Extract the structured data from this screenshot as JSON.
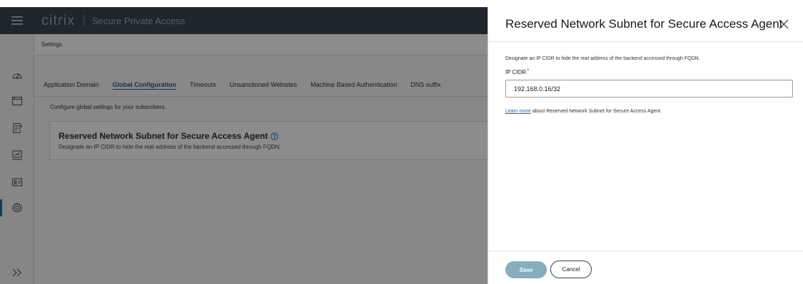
{
  "app": {
    "brand_logo": "citrix",
    "product_name": "Secure Private Access"
  },
  "nav": {
    "icons": [
      "menu-icon",
      "dashboard-icon",
      "applications-icon",
      "policies-icon",
      "monitor-icon",
      "directory-icon",
      "settings-icon",
      "expand-icon"
    ],
    "active_item": "settings-icon"
  },
  "main": {
    "breadcrumb": "Settings",
    "tabs": [
      {
        "label": "Application Domain",
        "active": false
      },
      {
        "label": "Global Configuration",
        "active": true
      },
      {
        "label": "Timeouts",
        "active": false
      },
      {
        "label": "Unsanctioned Websites",
        "active": false
      },
      {
        "label": "Machine Based Authentication",
        "active": false
      },
      {
        "label": "DNS suffix",
        "active": false
      }
    ],
    "subtitle": "Configure global settings for your subscribers.",
    "card": {
      "title": "Reserved Network Subnet for Secure Access Agent",
      "description": "Designate an IP CIDR to hide the real address of the backend accessed through FQDN."
    }
  },
  "panel": {
    "title": "Reserved Network Subnet for Secure Access Agent",
    "description": "Designate an IP CIDR to hide the real address of the backend accessed through FQDN.",
    "field_label": "IP CIDR",
    "required_mark": "*",
    "ip_value": "192.168.0.16/32",
    "learn_more_link": "Learn more",
    "learn_more_rest": " about Reserved Network Subnet for Secure Access Agent",
    "save_label": "Save",
    "cancel_label": "Cancel"
  },
  "colors": {
    "topbar": "#3a4652",
    "accent": "#0a74c4",
    "save_button": "#86aebc",
    "link": "#0a66b8",
    "required": "#d62b2b"
  }
}
